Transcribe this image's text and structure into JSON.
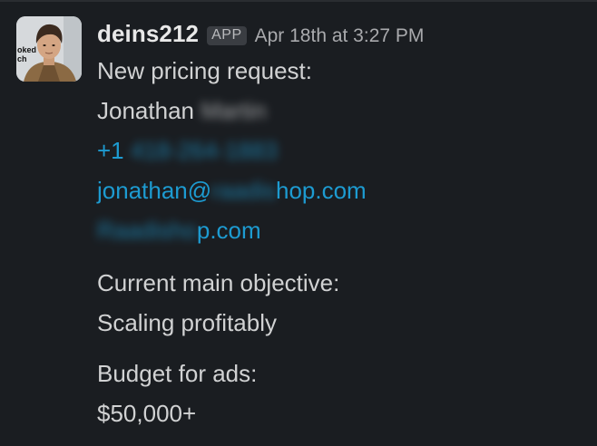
{
  "message": {
    "sender": "deins212",
    "badge": "APP",
    "timestamp": "Apr 18th at 3:27 PM",
    "avatar_text": "oked\nch",
    "heading": "New pricing request:",
    "name_first": "Jonathan",
    "name_last_redacted": "Martin",
    "phone_prefix": "+1",
    "phone_redacted": "418-264-1883",
    "email_prefix": "jonathan@",
    "email_redacted": "raadis",
    "email_suffix": "hop.com",
    "site_redacted": "Raadisho",
    "site_suffix": "p.com",
    "objective_label": "Current main objective:",
    "objective_value": "Scaling profitably",
    "budget_label": "Budget for ads:",
    "budget_value": "$50,000+"
  },
  "colors": {
    "background": "#1a1d21",
    "text": "#d1d2d3",
    "link": "#1d9bd1",
    "badge_bg": "#3a3d42",
    "timestamp": "#a9aaad"
  }
}
